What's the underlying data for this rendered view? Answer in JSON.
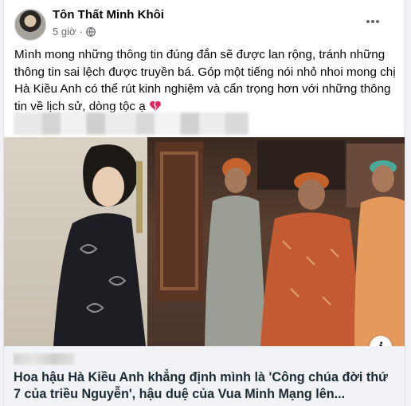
{
  "post": {
    "author": "Tôn Thất Minh Khôi",
    "time": "5 giờ",
    "more_label": "•••",
    "text": "Mình mong những thông tin đúng đắn sẽ được lan rộng, tránh những thông tin sai lệch được truyền bá. Góp một tiếng nói nhỏ nhoi mong chị Hà Kiều Anh có thể rút kinh nghiệm và cẩn trọng hơn với những thông tin về lịch sử, dòng tộc ạ",
    "emoji_icon": "broken-heart-icon"
  },
  "link": {
    "title": "Hoa hậu Hà Kiều Anh khẳng định mình là 'Công chúa đời thứ 7 của triều Nguyễn', hậu duệ của Vua Minh Mạng lên...",
    "info_label": "i"
  },
  "colors": {
    "secondary_text": "#65676b",
    "link_box_bg": "#f0f2f5",
    "heart_red": "#e0245e"
  }
}
